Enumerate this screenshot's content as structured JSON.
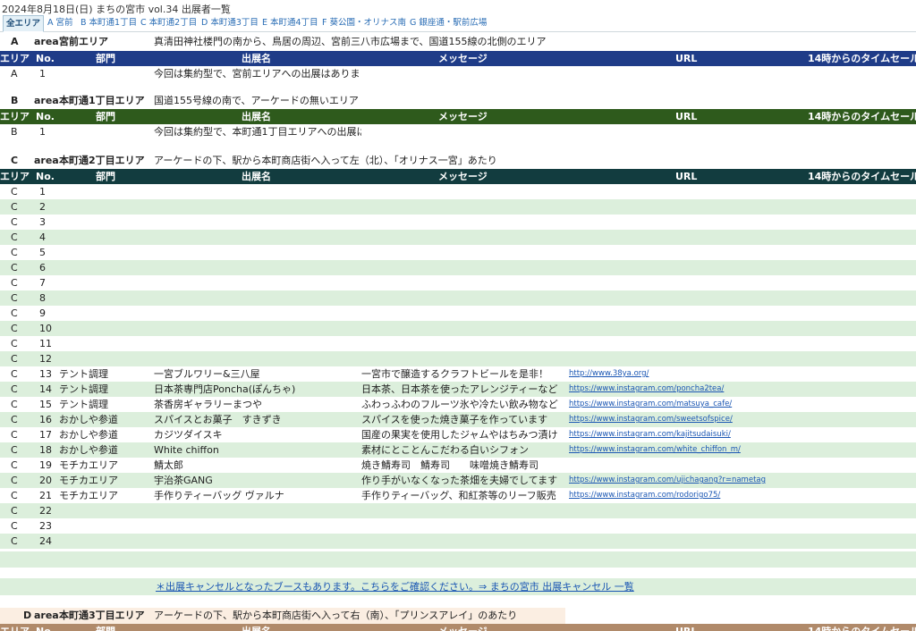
{
  "page": {
    "title": "2024年8月18日(日) まちの宮市 vol.34 出展者一覧"
  },
  "tabs": [
    {
      "label": "全エリア",
      "active": true
    },
    {
      "label": "A 宮前"
    },
    {
      "label": "B 本町通1丁目"
    },
    {
      "label": "C 本町通2丁目"
    },
    {
      "label": "D 本町通3丁目"
    },
    {
      "label": "E 本町通4丁目"
    },
    {
      "label": "F 葵公園・オリナス南"
    },
    {
      "label": "G 銀座通・駅前広場"
    }
  ],
  "columns": {
    "area": "エリア",
    "no": "No.",
    "dept": "部門",
    "name": "出展名",
    "message": "メッセージ",
    "url": "URL",
    "timesale": "14時からのタイムセール"
  },
  "area_word": "area",
  "sections": {
    "A": {
      "letter": "A",
      "name": "宮前エリア",
      "desc": "真清田神社楼門の南から、鳥居の周辺、宮前三八市広場まで、国道155線の北側のエリア",
      "rows": [
        {
          "area": "A",
          "no": "1",
          "name": "今回は集約型で、宮前エリアへの出展はありま"
        }
      ]
    },
    "B": {
      "letter": "B",
      "name": "本町通1丁目エリア",
      "desc": "国道155号線の南で、アーケードの無いエリア",
      "rows": [
        {
          "area": "B",
          "no": "1",
          "name": "今回は集約型で、本町通1丁目エリアへの出展は"
        }
      ]
    },
    "C": {
      "letter": "C",
      "name": "本町通2丁目エリア",
      "desc": "アーケードの下、駅から本町商店街へ入って左（北）、「オリナス一宮」あたり",
      "rows": [
        {
          "area": "C",
          "no": "1"
        },
        {
          "area": "C",
          "no": "2"
        },
        {
          "area": "C",
          "no": "3"
        },
        {
          "area": "C",
          "no": "4"
        },
        {
          "area": "C",
          "no": "5"
        },
        {
          "area": "C",
          "no": "6"
        },
        {
          "area": "C",
          "no": "7"
        },
        {
          "area": "C",
          "no": "8"
        },
        {
          "area": "C",
          "no": "9"
        },
        {
          "area": "C",
          "no": "10"
        },
        {
          "area": "C",
          "no": "11"
        },
        {
          "area": "C",
          "no": "12"
        },
        {
          "area": "C",
          "no": "13",
          "dept": "テント調理",
          "name": "一宮ブルワリー&三八屋",
          "message": "一宮市で醸造するクラフトビールを是非！",
          "url": "http://www.38ya.org/"
        },
        {
          "area": "C",
          "no": "14",
          "dept": "テント調理",
          "name": "日本茶専門店Poncha(ぽんちゃ)",
          "message": "日本茶、日本茶を使ったアレンジティーなど",
          "url": "https://www.instagram.com/poncha2tea/"
        },
        {
          "area": "C",
          "no": "15",
          "dept": "テント調理",
          "name": "茶香房ギャラリーまつや",
          "message": "ふわっふわのフルーツ氷や冷たい飲み物など",
          "url": "https://www.instagram.com/matsuya_cafe/"
        },
        {
          "area": "C",
          "no": "16",
          "dept": "おかしや参道",
          "name": "スパイスとお菓子　すきずき",
          "message": "スパイスを使った焼き菓子を作っています",
          "url": "https://www.instagram.com/sweetsofspice/"
        },
        {
          "area": "C",
          "no": "17",
          "dept": "おかしや参道",
          "name": "カジツダイスキ",
          "message": "国産の果実を使用したジャムやはちみつ漬け",
          "url": "https://www.instagram.com/kajitsudaisuki/"
        },
        {
          "area": "C",
          "no": "18",
          "dept": "おかしや参道",
          "name": "White chiffon",
          "message": "素材にとことんこだわる白いシフォン",
          "url": "https://www.instagram.com/white_chiffon_m/"
        },
        {
          "area": "C",
          "no": "19",
          "dept": "モチカエリア",
          "name": "鯖太郎",
          "message": "焼き鯖寿司　鯖寿司　　味噌焼き鯖寿司"
        },
        {
          "area": "C",
          "no": "20",
          "dept": "モチカエリア",
          "name": "宇治茶GANG",
          "message": "作り手がいなくなった茶畑を夫婦でしてます",
          "url": "https://www.instagram.com/ujichagang?r=nametag"
        },
        {
          "area": "C",
          "no": "21",
          "dept": "モチカエリア",
          "name": "手作りティーバッグ ヴァルナ",
          "message": "手作りティーバッグ、和紅茶等のリーフ販売",
          "url": "https://www.instagram.com/rodorigo75/"
        },
        {
          "area": "C",
          "no": "22"
        },
        {
          "area": "C",
          "no": "23"
        },
        {
          "area": "C",
          "no": "24"
        }
      ]
    },
    "D": {
      "letter": "D",
      "name": "本町通3丁目エリア",
      "desc": "アーケードの下、駅から本町商店街へ入って右（南）、「プリンスアレイ」のあたり"
    }
  },
  "cancel_link": "＊出展キャンセルとなったブースもあります。こちらをご確認ください。⇒ まちの宮市 出展キャンセル 一覧",
  "colors": {
    "A": "#1f3c88",
    "B": "#2e5a1c",
    "C": "#123c3f",
    "D": "#b08a6a",
    "alt_row": "#dcefdc"
  }
}
